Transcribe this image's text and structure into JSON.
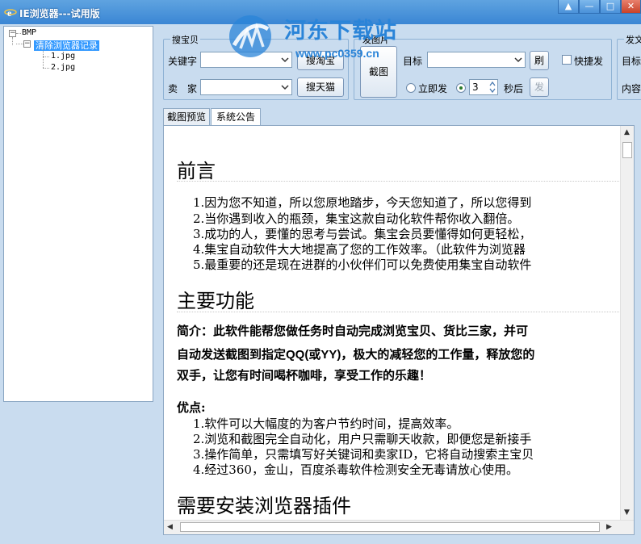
{
  "window": {
    "title": "IE浏览器---试用版",
    "controls": [
      "skin",
      "minimize",
      "maximize",
      "close"
    ]
  },
  "watermark": {
    "site_name": "河东下载站",
    "url": "www.pc0359.cn"
  },
  "tree": {
    "root": "BMP",
    "selected": "清除浏览器记录",
    "files": [
      "1.jpg",
      "2.jpg"
    ]
  },
  "search_group": {
    "title": "搜宝贝",
    "keyword_label": "关键字",
    "keyword_value": "",
    "search_taobao_button": "搜淘宝",
    "seller_label": "卖　家",
    "seller_value": "",
    "search_tmall_button": "搜天猫"
  },
  "send_image_group": {
    "title": "发图片",
    "capture_button": "截图",
    "target_label": "目标",
    "target_value": "",
    "refresh_button": "刷",
    "quick_send_label": "快捷发",
    "quick_send_checked": false,
    "send_now_label": "立即发",
    "send_delay_value": "3",
    "seconds_label": "秒后",
    "send_button": "发",
    "delayed_selected": true
  },
  "send_text_group": {
    "title": "发文",
    "target_label": "目标",
    "content_label": "内容"
  },
  "tabs": [
    {
      "label": "截图预览",
      "active": false
    },
    {
      "label": "系统公告",
      "active": true
    }
  ],
  "document": {
    "preface_heading": "前言",
    "preface_items": [
      "1.因为您不知道，所以您原地踏步，今天您知道了，所以您得到",
      "2.当你遇到收入的瓶颈，集宝这款自动化软件帮你收入翻倍。",
      "3.成功的人，要懂的思考与尝试。集宝会员要懂得如何更轻松，",
      "4.集宝自动软件大大地提高了您的工作效率。（此软件为浏览器",
      "5.最重要的还是现在进群的小伙伴们可以免费使用集宝自动软件"
    ],
    "features_heading": "主要功能",
    "intro_line1": "简介：此软件能帮您做任务时自动完成浏览宝贝、货比三家，并可",
    "intro_line2_a": "自动发送截图到指定",
    "intro_line2_b": "QQ(或YY)",
    "intro_line2_c": "，极大的减轻您的工作量，释放您的",
    "intro_line3": "双手，让您有时间喝杯咖啡，享受工作的乐趣！",
    "advantages_label": "优点:",
    "advantage_items": [
      "1.软件可以大幅度的为客户节约时间，提高效率。",
      "2.浏览和截图完全自动化，用户只需聊天收款，即便您是新接手",
      "3.操作简单，只需填写好关键词和卖家ID，它将自动搜索主宝贝",
      "4.经过360，金山，百度杀毒软件检测安全无毒请放心使用。"
    ],
    "plugin_heading": "需要安装浏览器插件"
  },
  "colors": {
    "titlebar": "#3a86d4",
    "background": "#c9dcef",
    "selection": "#3399ff",
    "watermark": "#2a84d8"
  }
}
